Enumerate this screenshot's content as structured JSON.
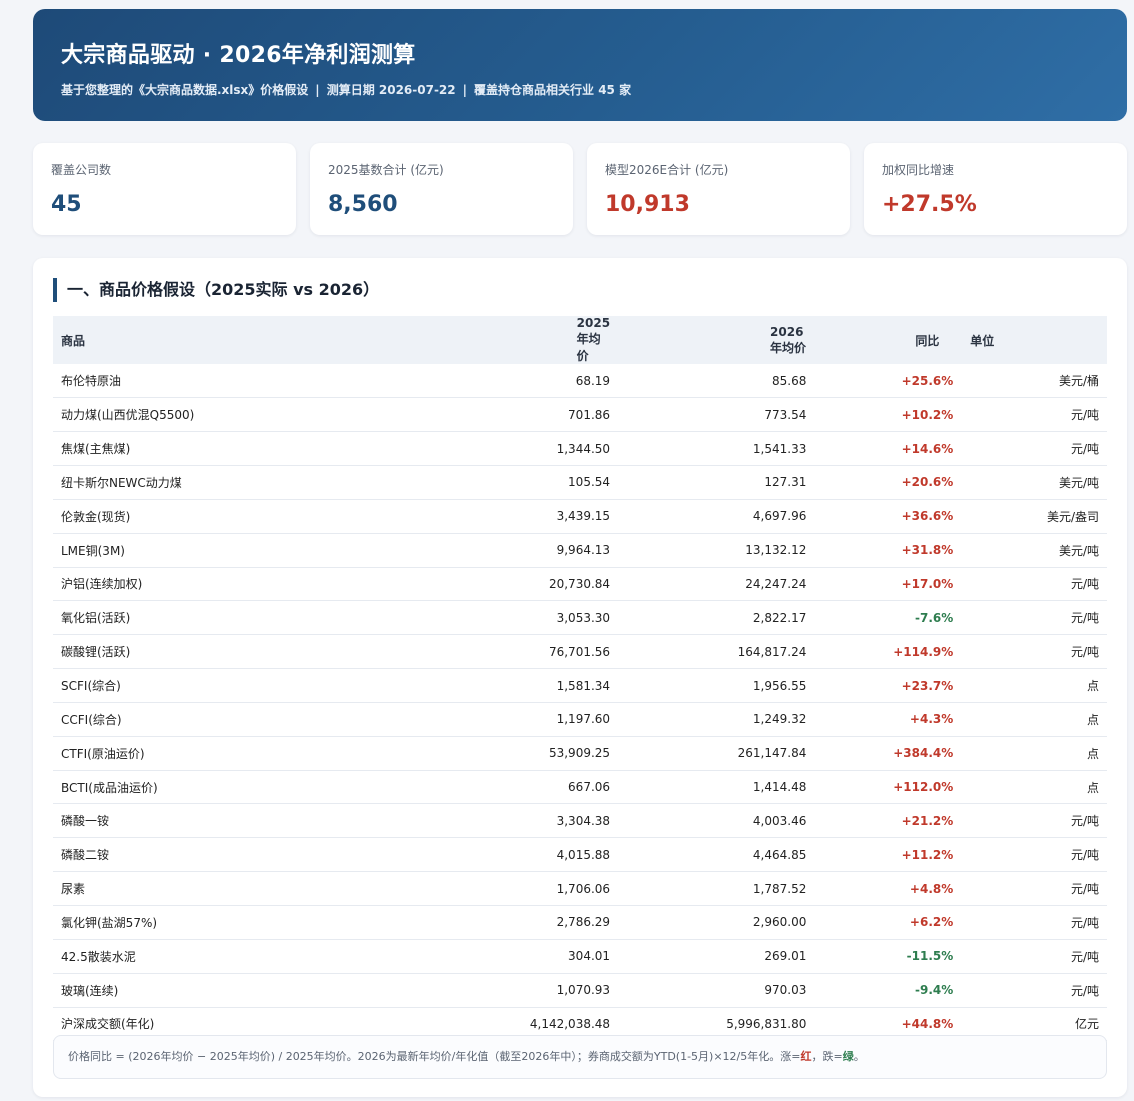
{
  "header": {
    "title": "大宗商品驱动 · 2026年净利润测算",
    "subtitle_part1": "基于您整理的《大宗商品数据.xlsx》价格假设",
    "subtitle_part2": "测算日期 2026-07-22",
    "subtitle_part3": "覆盖持仓商品相关行业 45 家",
    "separator": "|"
  },
  "kpis": [
    {
      "label": "覆盖公司数",
      "value": "45"
    },
    {
      "label": "2025基数合计 (亿元)",
      "value": "8,560"
    },
    {
      "label": "模型2026E合计 (亿元)",
      "value": "10,913"
    },
    {
      "label": "加权同比增速",
      "value": "+27.5%"
    }
  ],
  "section": {
    "title": "一、商品价格假设（2025实际 vs 2026）",
    "columns": [
      "商品",
      "2025年均价",
      "2026年均价",
      "同比",
      "单位"
    ],
    "rows": [
      {
        "name": "布伦特原油",
        "p2025": "68.19",
        "p2026": "85.68",
        "yoy": "+25.6%",
        "unit": "美元/桶"
      },
      {
        "name": "动力煤(山西优混Q5500)",
        "p2025": "701.86",
        "p2026": "773.54",
        "yoy": "+10.2%",
        "unit": "元/吨"
      },
      {
        "name": "焦煤(主焦煤)",
        "p2025": "1,344.50",
        "p2026": "1,541.33",
        "yoy": "+14.6%",
        "unit": "元/吨"
      },
      {
        "name": "纽卡斯尔NEWC动力煤",
        "p2025": "105.54",
        "p2026": "127.31",
        "yoy": "+20.6%",
        "unit": "美元/吨"
      },
      {
        "name": "伦敦金(现货)",
        "p2025": "3,439.15",
        "p2026": "4,697.96",
        "yoy": "+36.6%",
        "unit": "美元/盎司"
      },
      {
        "name": "LME铜(3M)",
        "p2025": "9,964.13",
        "p2026": "13,132.12",
        "yoy": "+31.8%",
        "unit": "美元/吨"
      },
      {
        "name": "沪铝(连续加权)",
        "p2025": "20,730.84",
        "p2026": "24,247.24",
        "yoy": "+17.0%",
        "unit": "元/吨"
      },
      {
        "name": "氧化铝(活跃)",
        "p2025": "3,053.30",
        "p2026": "2,822.17",
        "yoy": "-7.6%",
        "unit": "元/吨"
      },
      {
        "name": "碳酸锂(活跃)",
        "p2025": "76,701.56",
        "p2026": "164,817.24",
        "yoy": "+114.9%",
        "unit": "元/吨"
      },
      {
        "name": "SCFI(综合)",
        "p2025": "1,581.34",
        "p2026": "1,956.55",
        "yoy": "+23.7%",
        "unit": "点"
      },
      {
        "name": "CCFI(综合)",
        "p2025": "1,197.60",
        "p2026": "1,249.32",
        "yoy": "+4.3%",
        "unit": "点"
      },
      {
        "name": "CTFI(原油运价)",
        "p2025": "53,909.25",
        "p2026": "261,147.84",
        "yoy": "+384.4%",
        "unit": "点"
      },
      {
        "name": "BCTI(成品油运价)",
        "p2025": "667.06",
        "p2026": "1,414.48",
        "yoy": "+112.0%",
        "unit": "点"
      },
      {
        "name": "磷酸一铵",
        "p2025": "3,304.38",
        "p2026": "4,003.46",
        "yoy": "+21.2%",
        "unit": "元/吨"
      },
      {
        "name": "磷酸二铵",
        "p2025": "4,015.88",
        "p2026": "4,464.85",
        "yoy": "+11.2%",
        "unit": "元/吨"
      },
      {
        "name": "尿素",
        "p2025": "1,706.06",
        "p2026": "1,787.52",
        "yoy": "+4.8%",
        "unit": "元/吨"
      },
      {
        "name": "氯化钾(盐湖57%)",
        "p2025": "2,786.29",
        "p2026": "2,960.00",
        "yoy": "+6.2%",
        "unit": "元/吨"
      },
      {
        "name": "42.5散装水泥",
        "p2025": "304.01",
        "p2026": "269.01",
        "yoy": "-11.5%",
        "unit": "元/吨"
      },
      {
        "name": "玻璃(连续)",
        "p2025": "1,070.93",
        "p2026": "970.03",
        "yoy": "-9.4%",
        "unit": "元/吨"
      },
      {
        "name": "沪深成交额(年化)",
        "p2025": "4,142,038.48",
        "p2026": "5,996,831.80",
        "yoy": "+44.8%",
        "unit": "亿元"
      }
    ],
    "note": {
      "text": "价格同比 = (2026年均价 − 2025年均价) / 2025年均价。2026为最新年均价/年化值（截至2026年中）；券商成交额为YTD(1-5月)×12/5年化。涨=",
      "up_word": "红",
      "mid": "，跌=",
      "down_word": "绿",
      "end": "。"
    }
  },
  "colors": {
    "accent": "#1f4e7a",
    "up": "#c0392b",
    "down": "#2e7d4f",
    "header_start": "#1e4a78",
    "header_end": "#2f6ea6"
  }
}
